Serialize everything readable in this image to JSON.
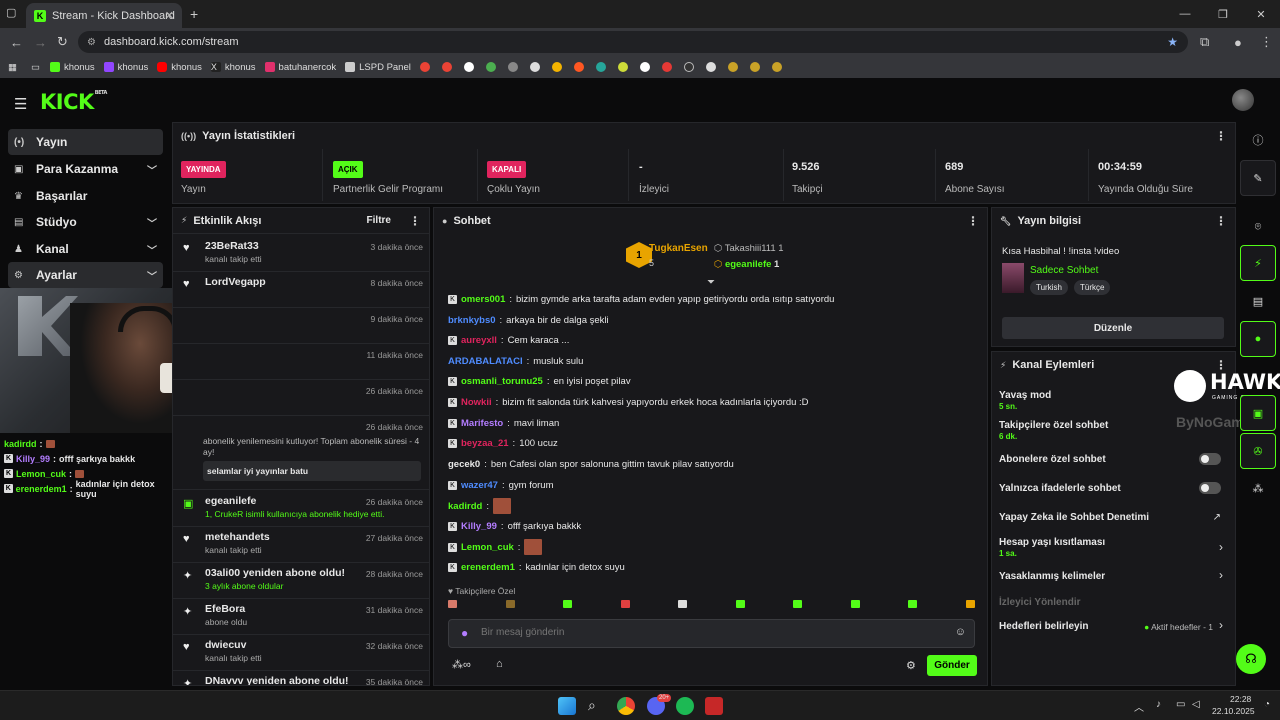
{
  "browser": {
    "tab_title": "Stream - Kick Dashboard",
    "url": "dashboard.kick.com/stream",
    "bookmarks": [
      {
        "label": "khonus",
        "color": "#53fc18"
      },
      {
        "label": "khonus",
        "color": "#9146ff"
      },
      {
        "label": "khonus",
        "color": "#ff0000"
      },
      {
        "label": "khonus",
        "color": "#dddddd"
      },
      {
        "label": "batuhanercok",
        "color": "#e1306c"
      },
      {
        "label": "LSPD Panel",
        "color": "#cccccc"
      }
    ]
  },
  "app": {
    "logo": "KICK",
    "logo_beta": "BETA"
  },
  "sidebar": {
    "items": [
      {
        "label": "Yayın",
        "icon": "broadcast-icon"
      },
      {
        "label": "Para Kazanma",
        "icon": "money-icon"
      },
      {
        "label": "Başarılar",
        "icon": "trophy-icon"
      },
      {
        "label": "Stüdyo",
        "icon": "studio-icon"
      },
      {
        "label": "Kanal",
        "icon": "channel-icon"
      },
      {
        "label": "Ayarlar",
        "icon": "gear-icon"
      }
    ]
  },
  "overlay_chat": [
    {
      "user": "kadirdd",
      "text": "",
      "color": "#53fc18"
    },
    {
      "user": "Killy_99",
      "text": "offf şarkıya bakkk",
      "color": "#b37dff"
    },
    {
      "user": "Lemon_cuk",
      "text": "",
      "color": "#53fc18"
    },
    {
      "user": "erenerdem1",
      "text": "kadınlar için detox suyu",
      "color": "#53fc18"
    }
  ],
  "stats": {
    "title": "Yayın İstatistikleri",
    "items": [
      {
        "value": "YAYINDA",
        "label": "Yayın",
        "pill": true,
        "pill_color": "#e0245e"
      },
      {
        "value": "AÇIK",
        "label": "Partnerlik Gelir Programı",
        "pill": true,
        "pill_color": "#53fc18"
      },
      {
        "value": "KAPALI",
        "label": "Çoklu Yayın",
        "pill": true,
        "pill_color": "#e0245e"
      },
      {
        "value": "-",
        "label": "İzleyici",
        "pill": false
      },
      {
        "value": "9.526",
        "label": "Takipçi",
        "pill": false
      },
      {
        "value": "689",
        "label": "Abone Sayısı",
        "pill": false
      },
      {
        "value": "00:34:59",
        "label": "Yayında Olduğu Süre",
        "pill": false
      }
    ]
  },
  "activity": {
    "title": "Etkinlik Akışı",
    "filter": "Filtre",
    "items": [
      {
        "name": "23BeRat33",
        "sub": "kanalı takip etti",
        "time": "3 dakika önce",
        "icon": "heart-icon"
      },
      {
        "name": "LordVegapp",
        "sub": "",
        "time": "8 dakika önce",
        "icon": "heart-icon"
      },
      {
        "name": "",
        "sub": "",
        "time": "9 dakika önce",
        "icon": "heart-icon"
      },
      {
        "name": "",
        "sub": "",
        "time": "11 dakika önce",
        "icon": "heart-icon"
      },
      {
        "name": "",
        "sub": "",
        "time": "26 dakika önce",
        "icon": "heart-icon"
      },
      {
        "name": "",
        "sub": "",
        "time": "26 dakika önce",
        "icon": "heart-icon"
      },
      {
        "name": "egeanilefe",
        "sub": "1, CrukeR isimli kullanıcıya abonelik hediye etti.",
        "time": "26 dakika önce",
        "icon": "gift-icon"
      },
      {
        "name": "metehandets",
        "sub": "kanalı takip etti",
        "time": "27 dakika önce",
        "icon": "heart-icon"
      },
      {
        "name": "03ali00 yeniden abone oldu!",
        "sub": "3 aylık abone oldular",
        "time": "28 dakika önce",
        "icon": "sparkle-icon"
      },
      {
        "name": "EfeBora",
        "sub": "abone oldu",
        "time": "31 dakika önce",
        "icon": "sparkle-icon"
      },
      {
        "name": "dwiecuv",
        "sub": "kanalı takip etti",
        "time": "32 dakika önce",
        "icon": "heart-icon"
      },
      {
        "name": "DNavvv yeniden abone oldu!",
        "sub": "",
        "time": "35 dakika önce",
        "icon": "sparkle-icon"
      }
    ],
    "resub_text": "abonelik yenilemesini kutluyor! Toplam abonelik süresi - 4 ay!",
    "resub_message": "selamlar iyi yayınlar batu"
  },
  "chat": {
    "title": "Sohbet",
    "leader": {
      "name": "TugkanEsen",
      "count": "5"
    },
    "others": [
      {
        "name": "Takashiii111",
        "count": "1"
      },
      {
        "name": "egeanilefe",
        "count": "1"
      }
    ],
    "messages": [
      {
        "user": "omers001",
        "text": "bizim gymde arka tarafta adam evden yapıp getiriyordu orda ısıtıp satıyordu",
        "color": "#53fc18"
      },
      {
        "user": "brknkybs0",
        "text": "arkaya bir de dalga şekli",
        "color": "#4f8cff"
      },
      {
        "user": "aureyxll",
        "text": "Cem karaca ...",
        "color": "#e0245e"
      },
      {
        "user": "ARDABALATACI",
        "text": "musluk sulu",
        "color": "#4f8cff"
      },
      {
        "user": "osmanli_torunu25",
        "text": "en iyisi poşet pilav",
        "color": "#53fc18"
      },
      {
        "user": "Nowkii",
        "text": "bizim fit salonda türk kahvesi yapıyordu erkek hoca kadınlarla içiyordu :D",
        "color": "#e0245e"
      },
      {
        "user": "Marifesto",
        "text": "mavi liman",
        "color": "#b37dff"
      },
      {
        "user": "beyzaa_21",
        "text": "100 ucuz",
        "color": "#e0245e"
      },
      {
        "user": "gecek0",
        "text": "ben Cafesi olan spor salonuna gittim tavuk pilav satıyordu",
        "color": "#e8e8e8"
      },
      {
        "user": "wazer47",
        "text": "gym forum",
        "color": "#4f8cff"
      },
      {
        "user": "kadirdd",
        "text": "",
        "color": "#53fc18"
      },
      {
        "user": "Killy_99",
        "text": "offf şarkıya bakkk",
        "color": "#b37dff"
      },
      {
        "user": "Lemon_cuk",
        "text": "",
        "color": "#53fc18"
      },
      {
        "user": "erenerdem1",
        "text": "kadınlar için detox suyu",
        "color": "#53fc18"
      }
    ],
    "followers_only": "Takipçilere Özel",
    "placeholder": "Bir mesaj gönderin",
    "send": "Gönder"
  },
  "stream_info": {
    "title": "Yayın bilgisi",
    "stream_title": "Kısa Hasbihal ! !insta !video",
    "category": "Sadece Sohbet",
    "tags": [
      "Turkish",
      "Türkçe"
    ],
    "edit": "Düzenle"
  },
  "channel_actions": {
    "title": "Kanal Eylemleri",
    "items": [
      {
        "label": "Yavaş mod",
        "sub": "5 sn."
      },
      {
        "label": "Takipçilere özel sohbet",
        "sub": "6 dk."
      },
      {
        "label": "Abonelere özel sohbet",
        "sub": ""
      },
      {
        "label": "Yalnızca ifadelerle sohbet",
        "sub": ""
      },
      {
        "label": "Yapay Zeka ile Sohbet Denetimi",
        "sub": ""
      },
      {
        "label": "Hesap yaşı kısıtlaması",
        "sub": "1 sa."
      },
      {
        "label": "Yasaklanmış kelimeler",
        "sub": ""
      },
      {
        "label": "İzleyici Yönlendir",
        "sub": ""
      },
      {
        "label": "Hedefleri belirleyin",
        "sub": ""
      }
    ],
    "goals_status": "Aktif hedefler - 1"
  },
  "overlay_brand": {
    "hawk": "HAWK",
    "hawk_sub": "GAMING CHAIR",
    "bynogame": "ByNoGame"
  },
  "taskbar": {
    "time": "22:28",
    "date": "22.10.2025",
    "discord_badge": "20+"
  },
  "colors": {
    "accent": "#53fc18",
    "live": "#e0245e",
    "panel": "#18181b"
  }
}
